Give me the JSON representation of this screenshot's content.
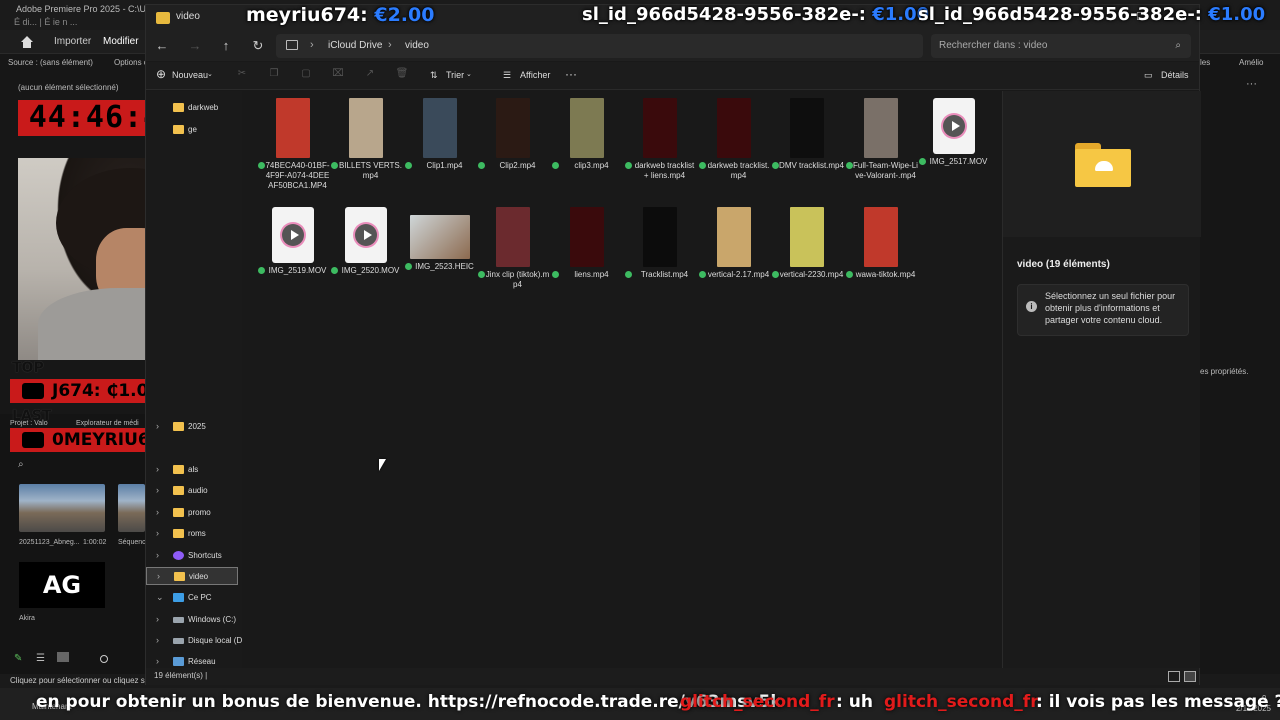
{
  "premiere": {
    "title": "Adobe Premiere Pro 2025 - C:\\Users\\",
    "subtitle": "É di... | É ie n ...",
    "menu": [
      "Importer",
      "Modifier"
    ],
    "source_label": "Source : (sans élément)",
    "options_label": "Options c",
    "no_selection": "(aucun élément sélectionné)",
    "project_tab": "Projet : Valo",
    "media_explorer_tab": "Explorateur de médi",
    "clip1_name": "20251123_Abneg...",
    "clip1_duration": "1:00:02",
    "clip2_name": "Séquence",
    "ag_text": "AG",
    "akira_label": "Akira",
    "right_tabs": [
      "les",
      "Amélio"
    ],
    "right_props": "es propriétés.",
    "status_text": "Cliquez pour sélectionner ou cliquez sur",
    "now_label": "Maintenant",
    "clock": "9",
    "date": "2/11/2025"
  },
  "stream": {
    "timer": "44:46:45",
    "top_label": "TOP",
    "last_label": "LAST",
    "top_banner": "J674: ₵1.00MEYRIL",
    "last_banner": "0MEYRIU674: ₵1.0(",
    "donations": [
      {
        "name": "meyriu674: ",
        "amount": "€2.00"
      },
      {
        "name": "sl_id_966d5428-9556-382e-: ",
        "amount": "€1.00"
      },
      {
        "name": "sl_id_966d5428-9556-382e-: ",
        "amount": "€1.00"
      }
    ],
    "ticker": {
      "promo": "en pour obtenir un bonus de bienvenue. https://refnocode.trade.re/v63msv5k",
      "user1": "glitch_second_fr",
      "msg1": ": uh",
      "user2": "glitch_second_fr",
      "msg2": ": il vois pas les message ?"
    }
  },
  "explorer": {
    "window_title": "video",
    "breadcrumb": [
      "iCloud Drive",
      "video"
    ],
    "search_placeholder": "Rechercher dans : video",
    "toolbar": {
      "new": "Nouveau",
      "sort": "Trier",
      "view": "Afficher",
      "more": "···",
      "details": "Détails"
    },
    "nav": [
      {
        "label": "darkweb",
        "type": "folder",
        "chev": ""
      },
      {
        "label": "ge",
        "type": "folder",
        "chev": ""
      },
      {
        "label": "2025",
        "type": "folder",
        "chev": "›"
      },
      {
        "label": "als",
        "type": "folder",
        "chev": "›"
      },
      {
        "label": "audio",
        "type": "folder",
        "chev": "›"
      },
      {
        "label": "promo",
        "type": "folder",
        "chev": "›"
      },
      {
        "label": "roms",
        "type": "folder",
        "chev": "›"
      },
      {
        "label": "Shortcuts",
        "type": "shortcut",
        "chev": "›"
      },
      {
        "label": "video",
        "type": "folder",
        "chev": "›"
      },
      {
        "label": "Ce PC",
        "type": "pc",
        "chev": "⌄"
      },
      {
        "label": "Windows (C:)",
        "type": "drive",
        "chev": "›"
      },
      {
        "label": "Disque local (D",
        "type": "drive",
        "chev": "›"
      },
      {
        "label": "Réseau",
        "type": "net",
        "chev": "›"
      }
    ],
    "files": [
      {
        "name": "74BECA40-01BF-4F9F-A074-4DEEAF50BCA1.MP4",
        "thumb": "#c0392b"
      },
      {
        "name": "BILLETS VERTS.mp4",
        "thumb": "#b8a68c"
      },
      {
        "name": "Clip1.mp4",
        "thumb": "#3a4a5a"
      },
      {
        "name": "Clip2.mp4",
        "thumb": "#2b1a14"
      },
      {
        "name": "clip3.mp4",
        "thumb": "#7d7a52"
      },
      {
        "name": "darkweb tracklist + liens.mp4",
        "thumb": "#3a0a0c"
      },
      {
        "name": "darkweb tracklist.mp4",
        "thumb": "#3a0a0c"
      },
      {
        "name": "DMV tracklist.mp4",
        "thumb": "#0e0e0e"
      },
      {
        "name": "Full-Team-Wipe-Live-Valorant-.mp4",
        "thumb": "#7a7068"
      },
      {
        "name": "IMG_2517.MOV",
        "thumb": "mov"
      },
      {
        "name": "IMG_2519.MOV",
        "thumb": "mov"
      },
      {
        "name": "IMG_2520.MOV",
        "thumb": "mov"
      },
      {
        "name": "IMG_2523.HEIC",
        "thumb": "wide"
      },
      {
        "name": "Jinx clip (tiktok).mp4",
        "thumb": "#6b2a2e"
      },
      {
        "name": "liens.mp4",
        "thumb": "#3a0a0c"
      },
      {
        "name": "Tracklist.mp4",
        "thumb": "#0c0c0c"
      },
      {
        "name": "vertical-2.17.mp4",
        "thumb": "#c9a66b"
      },
      {
        "name": "vertical-2230.mp4",
        "thumb": "#c9c25a"
      },
      {
        "name": "wawa-tiktok.mp4",
        "thumb": "#c0392b"
      }
    ],
    "details": {
      "title": "video (19 éléments)",
      "info": "Sélectionnez un seul fichier pour obtenir plus d'informations et partager votre contenu cloud."
    },
    "status_count": "19 élément(s)  |"
  }
}
